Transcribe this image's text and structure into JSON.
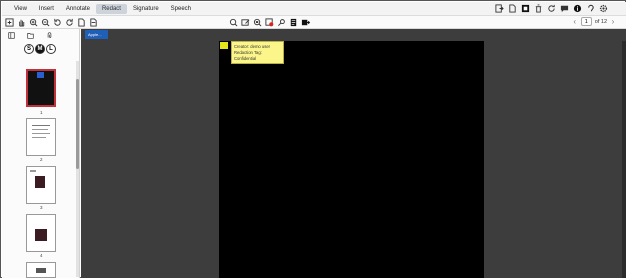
{
  "menu": {
    "tabs": [
      "View",
      "Insert",
      "Annotate",
      "Redact",
      "Signature",
      "Speech"
    ],
    "active_tab": "Redact",
    "right_icons": [
      "exit-icon",
      "file-icon",
      "stamp-icon",
      "trash-icon",
      "refresh-icon",
      "chat-icon",
      "info-icon",
      "ear-icon",
      "settings-icon"
    ]
  },
  "toolbar": {
    "left_icons": [
      "fit-page-icon",
      "hand-icon",
      "zoom-in-icon",
      "zoom-out-icon",
      "rotate-left-icon",
      "rotate-right-icon",
      "single-page-icon",
      "split-page-icon"
    ],
    "center_icons": [
      "search-icon",
      "redact-area-icon",
      "redact-search-icon",
      "remove-redaction-icon",
      "pin-icon",
      "document-icon",
      "apply-redaction-icon"
    ],
    "page_current": "1",
    "page_total_text": "of 12"
  },
  "sidebar": {
    "icons": [
      "thumbnails-icon",
      "folder-icon",
      "attachments-icon"
    ],
    "size_options": [
      "S",
      "M",
      "L"
    ],
    "active_size": "M",
    "thumbnails": [
      {
        "num": "1",
        "selected": true
      },
      {
        "num": "2",
        "selected": false
      },
      {
        "num": "3",
        "selected": false
      },
      {
        "num": "4",
        "selected": false
      },
      {
        "num": "5",
        "selected": false
      }
    ]
  },
  "document": {
    "tab_label": "Apple...",
    "note": {
      "line1": "Creator: demo user",
      "line2": "Redaction Tag: Confidential"
    }
  },
  "colors": {
    "page": "#000000",
    "workspace": "#3d3d3d",
    "note": "#fbf58a",
    "tab": "#1f5fb8",
    "selected_thumb_border": "#c0313a"
  }
}
